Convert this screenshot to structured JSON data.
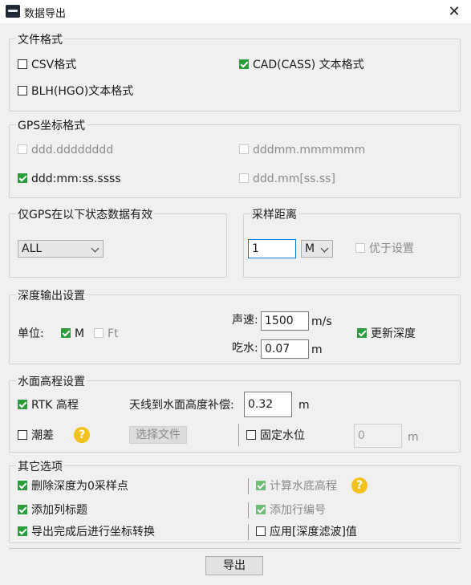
{
  "window": {
    "title": "数据导出",
    "close_glyph": "✕"
  },
  "file_format": {
    "legend": "文件格式",
    "csv": {
      "label": "CSV格式",
      "checked": false
    },
    "cad": {
      "label": "CAD(CASS) 文本格式",
      "checked": true
    },
    "blh": {
      "label": "BLH(HGO)文本格式",
      "checked": false
    }
  },
  "gps_format": {
    "legend": "GPS坐标格式",
    "opt1": {
      "label": "ddd.dddddddd",
      "checked": false,
      "enabled": false
    },
    "opt2": {
      "label": "dddmm.mmmmmm",
      "checked": false,
      "enabled": false
    },
    "opt3": {
      "label": "ddd:mm:ss.ssss",
      "checked": true,
      "enabled": true
    },
    "opt4": {
      "label": "ddd.mm[ss.ss]",
      "checked": false,
      "enabled": false
    }
  },
  "gps_status": {
    "legend": "仅GPS在以下状态数据有效",
    "selected": "ALL"
  },
  "sampling": {
    "legend": "采样距离",
    "value": "1",
    "unit": "M",
    "priority": {
      "label": "优于设置",
      "checked": false,
      "enabled": false
    }
  },
  "depth_output": {
    "legend": "深度输出设置",
    "unit_label": "单位:",
    "unit_m": {
      "label": "M",
      "checked": true
    },
    "unit_ft": {
      "label": "Ft",
      "checked": false
    },
    "sound_speed_label": "声速:",
    "sound_speed_value": "1500",
    "sound_speed_unit": "m/s",
    "draft_label": "吃水:",
    "draft_value": "0.07",
    "draft_unit": "m",
    "update_depth": {
      "label": "更新深度",
      "checked": true
    }
  },
  "water_elevation": {
    "legend": "水面高程设置",
    "rtk": {
      "label": "RTK 高程",
      "checked": true
    },
    "antenna_label": "天线到水面高度补偿:",
    "antenna_value": "0.32",
    "antenna_unit": "m",
    "tide": {
      "label": "潮差",
      "checked": false
    },
    "select_file_button": "选择文件",
    "fixed_level": {
      "label": "固定水位",
      "checked": false
    },
    "fixed_value": "0",
    "fixed_unit": "m"
  },
  "other": {
    "legend": "其它选项",
    "delete_zero": {
      "label": "删除深度为0采样点",
      "checked": true
    },
    "calc_bottom": {
      "label": "计算水底高程",
      "checked": true,
      "enabled": false
    },
    "add_header": {
      "label": "添加列标题",
      "checked": true
    },
    "add_row_no": {
      "label": "添加行编号",
      "checked": true,
      "enabled": false
    },
    "coord_convert": {
      "label": "导出完成后进行坐标转换",
      "checked": true
    },
    "apply_filter": {
      "label": "应用[深度滤波]值",
      "checked": false
    }
  },
  "export_button": "导出",
  "colors": {
    "check_green": "#2c9b3c",
    "help_yellow": "#f4c21e",
    "focus_blue": "#0078d7"
  }
}
